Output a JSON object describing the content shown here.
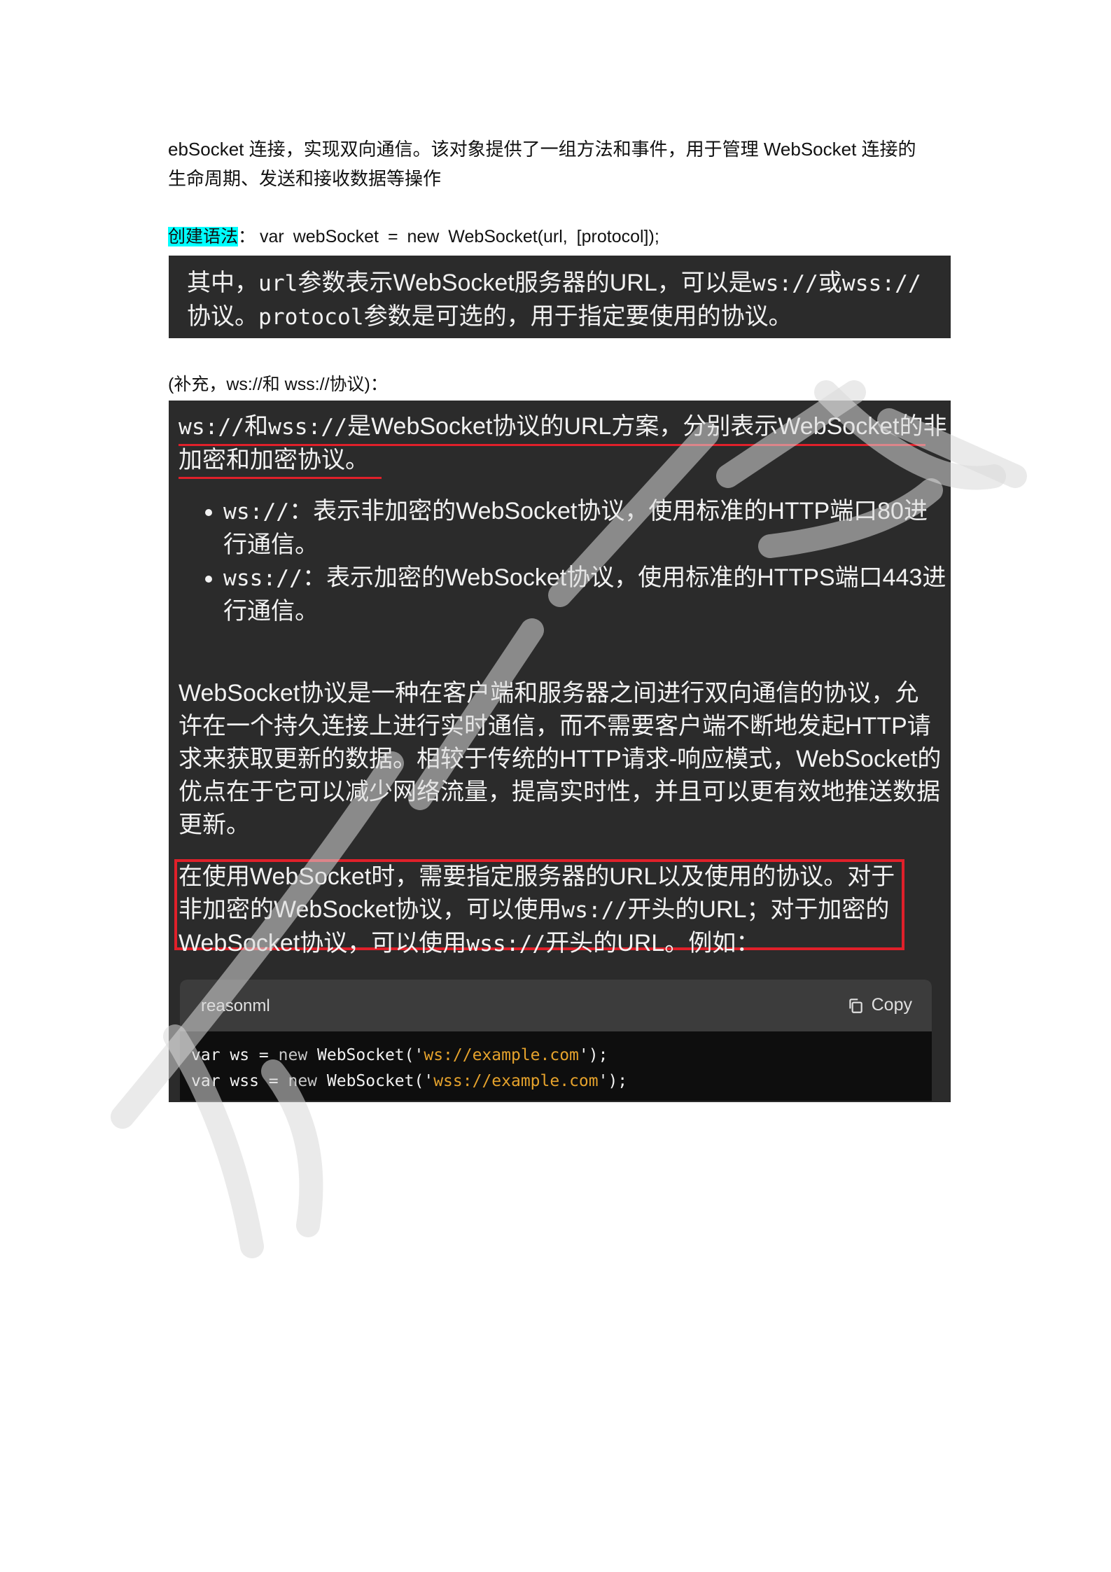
{
  "intro": {
    "line1": "ebSocket 连接，实现双向通信。该对象提供了一组方法和事件，用于管理 WebSocket 连接的",
    "line2": "生命周期、发送和接收数据等操作"
  },
  "syntax": {
    "label": "创建语法",
    "colon": "：",
    "code": "var webSocket = new WebSocket(url, [protocol]);"
  },
  "box1": {
    "t1": "其中，",
    "m1": "url",
    "t2": "参数表示WebSocket服务器的URL，可以是",
    "m2": "ws://",
    "t3": "或",
    "m3": "wss://",
    "t4": "协议。",
    "m4": "protocol",
    "t5": "参数是可选的，用于指定要使用的协议。"
  },
  "supplement": "(补充，ws://和 wss://协议)：",
  "box2": {
    "heading": {
      "m1": "ws://",
      "t1": "和",
      "m2": "wss://",
      "t2": "是WebSocket协议的URL方案，分别表示WebSocket的非加密和加密协议。"
    },
    "bullets": [
      {
        "code": "ws://",
        "text": "：表示非加密的WebSocket协议，使用标准的HTTP端口80进行通信。"
      },
      {
        "code": "wss://",
        "text": "：表示加密的WebSocket协议，使用标准的HTTPS端口443进行通信。"
      }
    ],
    "paragraph": "WebSocket协议是一种在客户端和服务器之间进行双向通信的协议，允许在一个持久连接上进行实时通信，而不需要客户端不断地发起HTTP请求来获取更新的数据。相较于传统的HTTP请求-响应模式，WebSocket的优点在于它可以减少网络流量，提高实时性，并且可以更有效地推送数据更新。",
    "boxed": {
      "t1": "在使用WebSocket时，需要指定服务器的URL以及使用的协议。对于非加密的WebSocket协议，可以使用",
      "m1": "ws://",
      "t2": "开头的URL；对于加密的WebSocket协议，可以使用",
      "m2": "wss://",
      "t3": "开头的URL。例如："
    },
    "code": {
      "language": "reasonml",
      "copy_label": "Copy",
      "copy_icon": "copy-icon",
      "lines": [
        {
          "a": "var ws = ",
          "kw": "new",
          "b": " WebSocket('",
          "s": "ws://example.com",
          "c": "');"
        },
        {
          "a": "var wss = ",
          "kw": "new",
          "b": " WebSocket('",
          "s": "wss://example.com",
          "c": "');"
        }
      ]
    }
  }
}
